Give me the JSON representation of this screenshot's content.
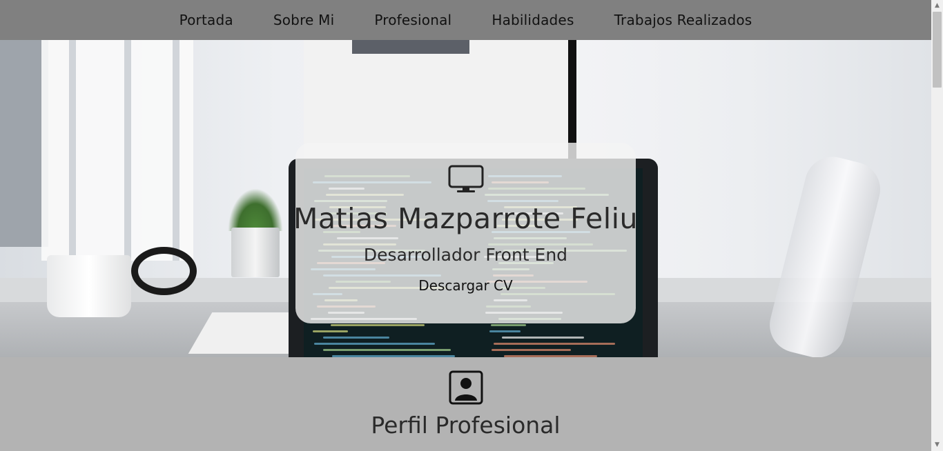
{
  "nav": {
    "items": [
      {
        "label": "Portada"
      },
      {
        "label": "Sobre Mi"
      },
      {
        "label": "Profesional"
      },
      {
        "label": "Habilidades"
      },
      {
        "label": "Trabajos Realizados"
      }
    ]
  },
  "hero": {
    "icon": "desktop-monitor-icon",
    "name": "Matias Mazparrote Feliu",
    "role": "Desarrollador Front End",
    "cv_label": "Descargar CV",
    "background_image": "desk-with-laptop-code-photo"
  },
  "profile": {
    "icon": "user-portrait-icon",
    "title": "Perfil Profesional"
  },
  "colors": {
    "nav_bg": "#808080",
    "section_bg": "#b3b3b3",
    "card_bg": "#f4f4f4",
    "text": "#2a2a2a"
  }
}
